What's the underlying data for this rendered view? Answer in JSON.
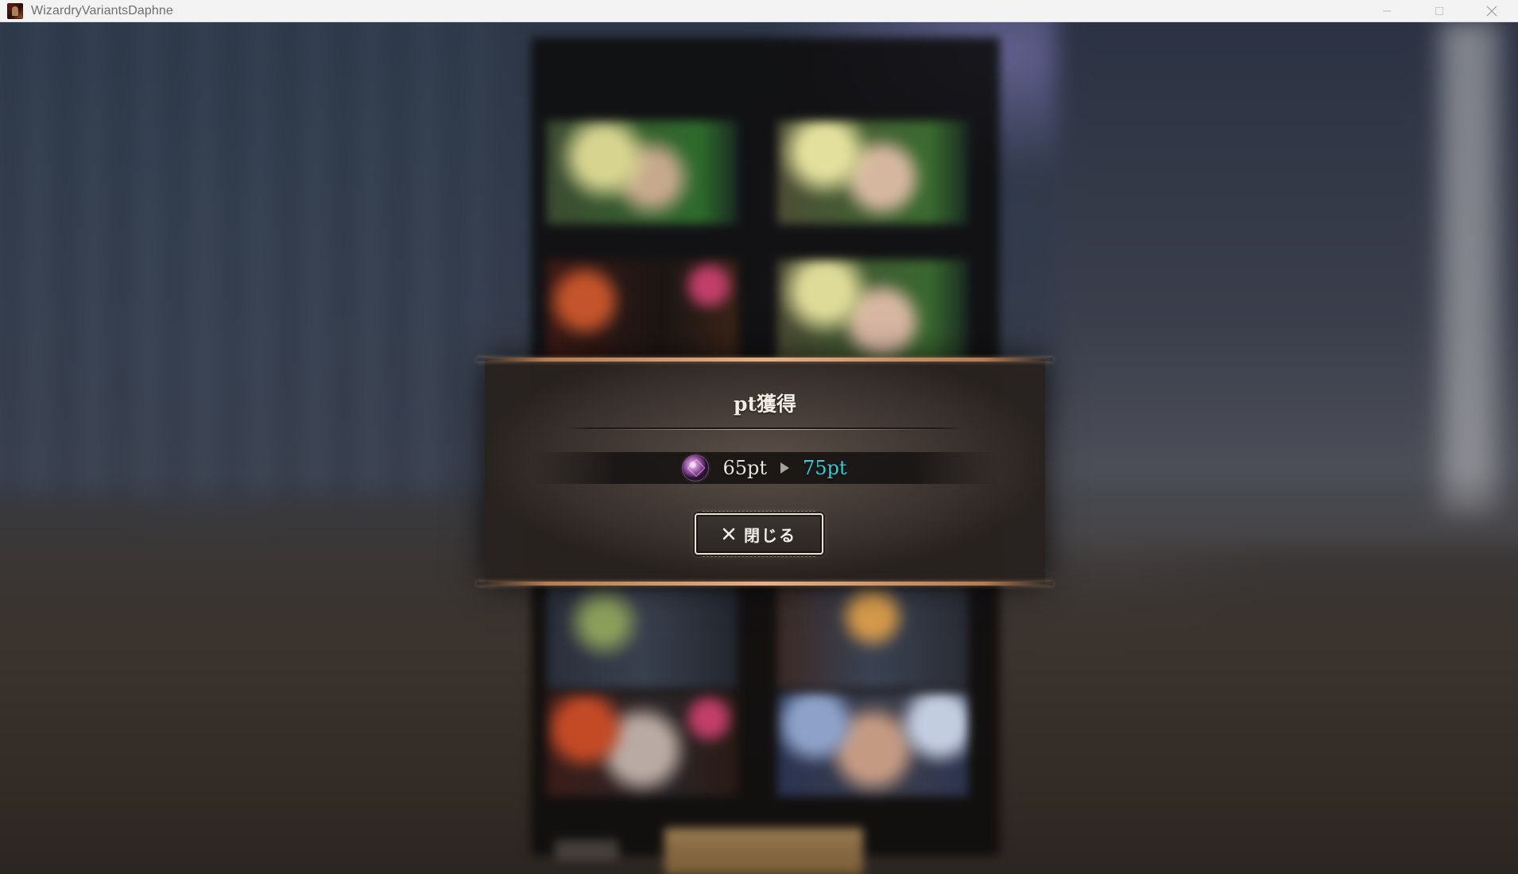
{
  "window": {
    "title": "WizardryVariantsDaphne",
    "app_icon": "wizardry-app-icon",
    "controls": [
      "minimize-icon",
      "maximize-icon",
      "close-icon"
    ]
  },
  "dialog": {
    "title": "pt獲得",
    "points": {
      "icon": "gem-medal-icon",
      "from": "65pt",
      "to": "75pt",
      "to_color": "#30cfd8"
    },
    "close_button": {
      "icon": "x-icon",
      "label": "閉じる"
    }
  },
  "colors": {
    "accent_frame": "#e2b28b",
    "dialog_bg": "#3a322e",
    "highlight_cyan": "#30cfd8"
  }
}
